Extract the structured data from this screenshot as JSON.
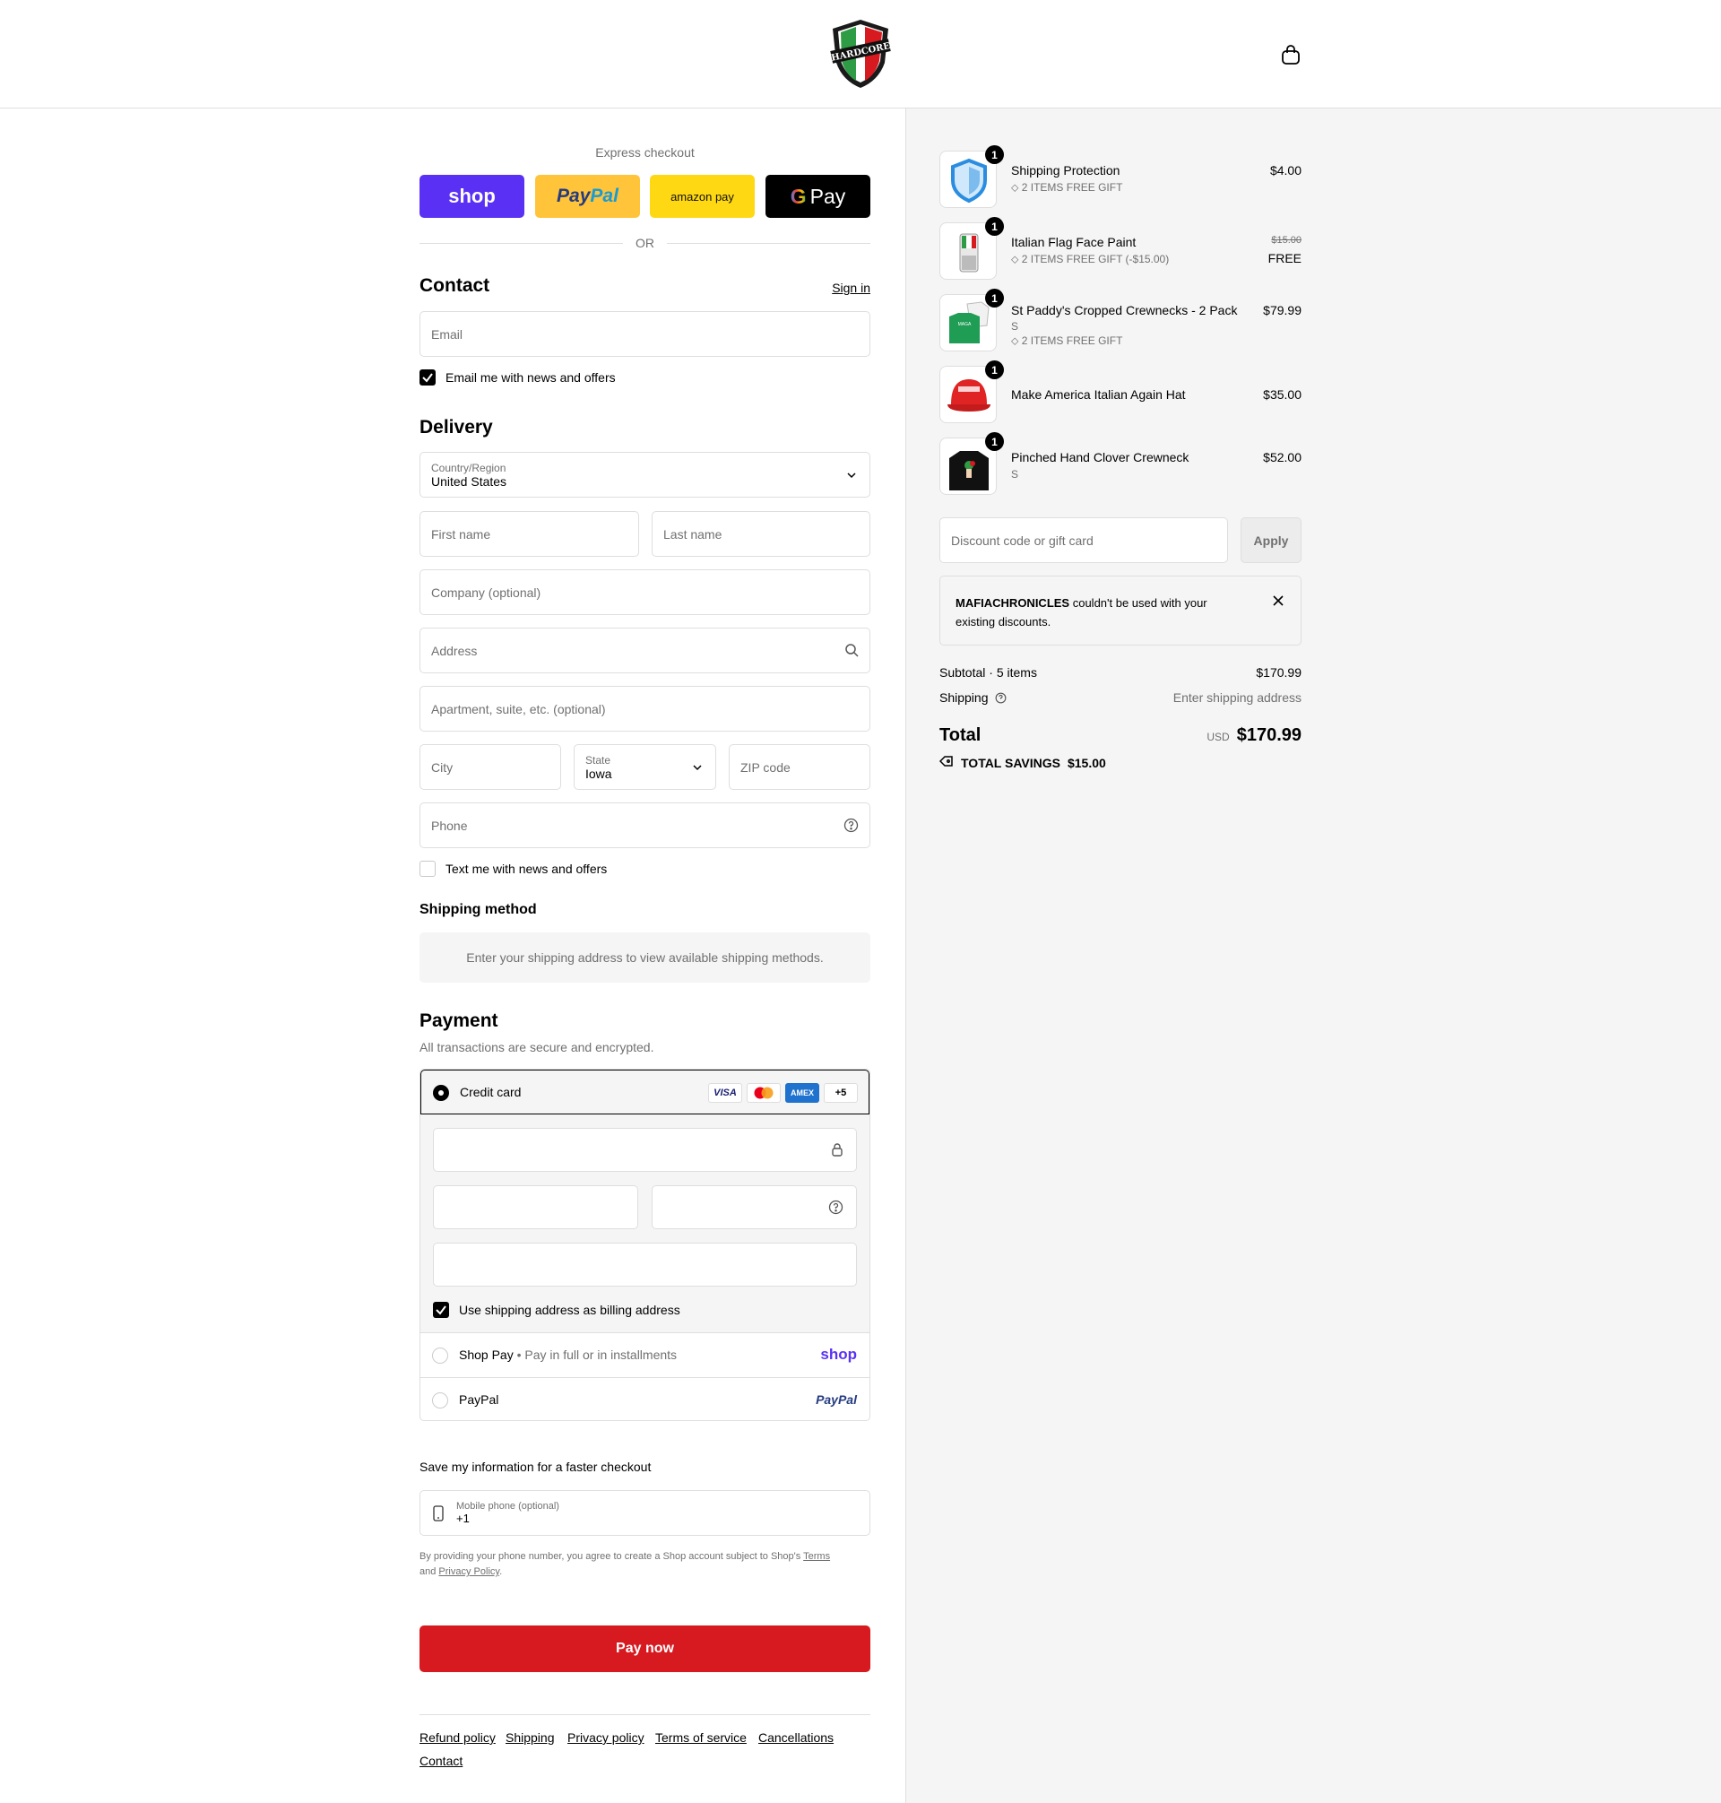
{
  "colors": {
    "accent": "#d71920",
    "shop": "#5a31f4",
    "paypal_yellow": "#ffc439",
    "amazon_yellow": "#ffd814",
    "summary_bg": "#f5f5f5"
  },
  "brand": {
    "logo_text": "HARDCORE"
  },
  "express": {
    "title": "Express checkout",
    "shop_label": "shop",
    "paypal_label_a": "Pay",
    "paypal_label_b": "Pal",
    "amazon_label": "amazon pay",
    "gpay_label": "Pay",
    "or_label": "OR"
  },
  "contact": {
    "heading": "Contact",
    "sign_in": "Sign in",
    "email_placeholder": "Email",
    "newsletter_label": "Email me with news and offers"
  },
  "delivery": {
    "heading": "Delivery",
    "country_label": "Country/Region",
    "country_value": "United States",
    "first_name": "First name",
    "last_name": "Last name",
    "company": "Company (optional)",
    "address": "Address",
    "apartment": "Apartment, suite, etc. (optional)",
    "city": "City",
    "state_label": "State",
    "state_value": "Iowa",
    "zip": "ZIP code",
    "phone": "Phone",
    "sms_label": "Text me with news and offers"
  },
  "shipping_method": {
    "heading": "Shipping method",
    "message": "Enter your shipping address to view available shipping methods."
  },
  "payment": {
    "heading": "Payment",
    "subtitle": "All transactions are secure and encrypted.",
    "credit_card_label": "Credit card",
    "card_brands": [
      "VISA",
      "",
      "AMEX",
      "+5"
    ],
    "billing_label": "Use shipping address as billing address",
    "shop_pay_label": "Shop Pay",
    "shop_pay_sub": "Pay in full or in installments",
    "shop_pay_logo": "shop",
    "paypal_label": "PayPal",
    "paypal_logo": "PayPal"
  },
  "save_info": {
    "heading": "Save my information for a faster checkout",
    "phone_label": "Mobile phone (optional)",
    "phone_value": "+1",
    "legal_a": "By providing your phone number, you agree to create a Shop account subject to Shop's ",
    "terms": "Terms",
    "legal_and": "and ",
    "privacy": "Privacy Policy",
    "legal_end": "."
  },
  "pay_now": "Pay now",
  "footer_links": [
    "Refund policy",
    "Shipping",
    "Privacy policy",
    "Terms of service",
    "Cancellations",
    "Contact"
  ],
  "summary": {
    "items": [
      {
        "name": "Shipping Protection",
        "variant": "",
        "discount": "2 ITEMS FREE GIFT",
        "price": "$4.00",
        "original": "",
        "qty": "1"
      },
      {
        "name": "Italian Flag Face Paint",
        "variant": "",
        "discount": "2 ITEMS FREE GIFT (-$15.00)",
        "price": "FREE",
        "original": "$15.00",
        "qty": "1"
      },
      {
        "name": "St Paddy's Cropped Crewnecks - 2 Pack",
        "variant": "S",
        "discount": "2 ITEMS FREE GIFT",
        "price": "$79.99",
        "original": "",
        "qty": "1"
      },
      {
        "name": "Make America Italian Again Hat",
        "variant": "",
        "discount": "",
        "price": "$35.00",
        "original": "",
        "qty": "1"
      },
      {
        "name": "Pinched Hand Clover Crewneck",
        "variant": "S",
        "discount": "",
        "price": "$52.00",
        "original": "",
        "qty": "1"
      }
    ],
    "discount_placeholder": "Discount code or gift card",
    "apply": "Apply",
    "error_code": "MAFIACHRONICLES",
    "error_text": " couldn't be used with your existing discounts.",
    "subtotal_label": "Subtotal · 5 items",
    "subtotal_value": "$170.99",
    "shipping_label": "Shipping",
    "shipping_value": "Enter shipping address",
    "total_label": "Total",
    "currency": "USD",
    "total_value": "$170.99",
    "savings_label": "TOTAL SAVINGS",
    "savings_value": "$15.00"
  }
}
